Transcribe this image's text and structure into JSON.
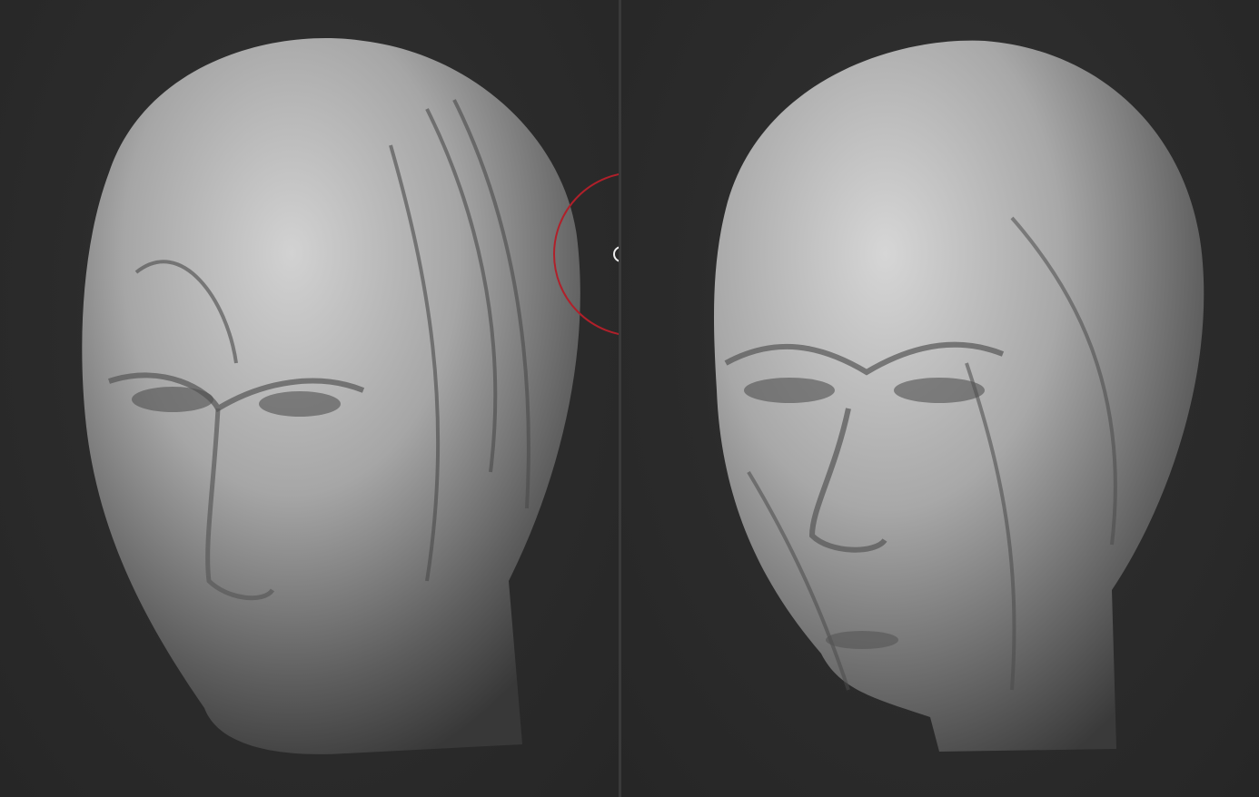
{
  "viewports": [
    {
      "id": "left",
      "subject": "sculpted-head-front"
    },
    {
      "id": "right",
      "subject": "sculpted-head-three-quarter"
    }
  ],
  "colors": {
    "background": "#2a2a2a",
    "clay": "#9a9a9a",
    "clay_highlight": "#d0d0d0",
    "clay_shadow": "#3c3c3c",
    "brush_cursor": "#b0202a"
  }
}
